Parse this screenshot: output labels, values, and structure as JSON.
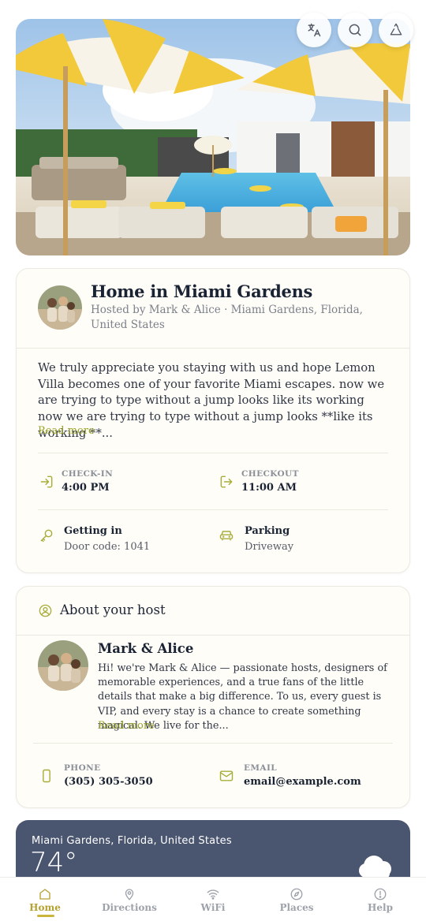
{
  "top_actions": [
    {
      "icon": "translate-icon"
    },
    {
      "icon": "search-icon"
    },
    {
      "icon": "recycle-icon"
    }
  ],
  "listing": {
    "title": "Home in Miami Gardens",
    "subtitle": "Hosted by Mark & Alice · Miami Gardens, Florida, United States",
    "description": "We truly appreciate you staying with us and hope Lemon Villa becomes one of your favorite Miami escapes. now we are trying to type without a jump looks like its working now we are trying to type without a jump looks **like its working **...",
    "read_more": "Read more",
    "checkin": {
      "label": "CHECK-IN",
      "value": "4:00 PM"
    },
    "checkout": {
      "label": "CHECKOUT",
      "value": "11:00 AM"
    },
    "getting_in": {
      "label": "Getting in",
      "value": "Door code: 1041"
    },
    "parking": {
      "label": "Parking",
      "value": "Driveway"
    }
  },
  "host": {
    "section_title": "About your host",
    "name": "Mark & Alice",
    "bio": "Hi! we're Mark & Alice — passionate hosts, designers of memorable experiences, and a true fans of the little details that make a big difference. To us, every guest is VIP, and every stay is a chance to create something magical. We live for the...",
    "read_more": "Read more",
    "phone": {
      "label": "PHONE",
      "value": "(305) 305-3050"
    },
    "email": {
      "label": "EMAIL",
      "value": "email@example.com"
    }
  },
  "weather": {
    "location": "Miami Gardens, Florida, United States",
    "temperature": "74°"
  },
  "nav": {
    "items": [
      {
        "label": "Home",
        "icon": "home-icon",
        "active": true
      },
      {
        "label": "Directions",
        "icon": "map-pin-icon"
      },
      {
        "label": "WiFi",
        "icon": "wifi-icon"
      },
      {
        "label": "Places",
        "icon": "compass-icon"
      },
      {
        "label": "Help",
        "icon": "help-icon"
      }
    ]
  },
  "colors": {
    "accent": "#9aa32a",
    "nav_active": "#b5a233",
    "weather_bg": "#4a5570"
  }
}
